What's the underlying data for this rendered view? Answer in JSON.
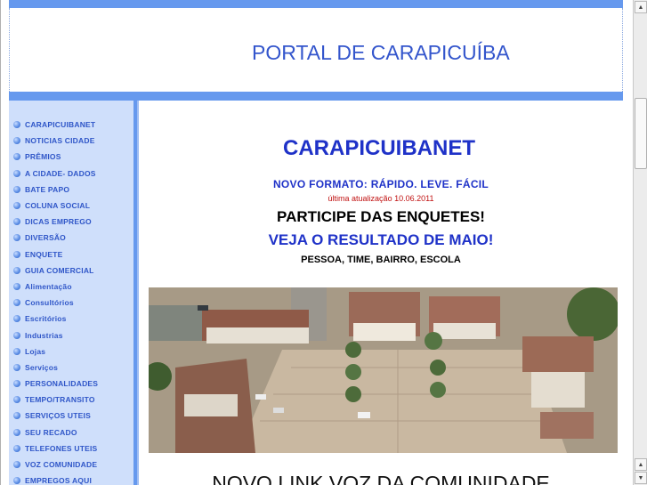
{
  "header": {
    "title": "PORTAL DE CARAPICUÍBA"
  },
  "sidebar": {
    "items": [
      {
        "label": "CARAPICUIBANET"
      },
      {
        "label": "NOTICIAS CIDADE"
      },
      {
        "label": "PRÊMIOS"
      },
      {
        "label": "A CIDADE- DADOS"
      },
      {
        "label": "BATE PAPO"
      },
      {
        "label": "COLUNA SOCIAL"
      },
      {
        "label": "DICAS EMPREGO"
      },
      {
        "label": "DIVERSÃO"
      },
      {
        "label": "ENQUETE"
      },
      {
        "label": "GUIA COMERCIAL"
      },
      {
        "label": "Alimentação"
      },
      {
        "label": "Consultórios"
      },
      {
        "label": "Escritórios"
      },
      {
        "label": "Industrias"
      },
      {
        "label": "Lojas"
      },
      {
        "label": "Serviços"
      },
      {
        "label": "PERSONALIDADES"
      },
      {
        "label": "TEMPO/TRANSITO"
      },
      {
        "label": "SERVIÇOS UTEIS"
      },
      {
        "label": "SEU RECADO"
      },
      {
        "label": "TELEFONES UTEIS"
      },
      {
        "label": "VOZ COMUNIDADE"
      },
      {
        "label": "EMPREGOS AQUI"
      }
    ]
  },
  "main": {
    "site_title": "CARAPICUIBANET",
    "tagline": "NOVO FORMATO: RÁPIDO. LEVE. FÁCIL",
    "updated": "última atualização  10.06.2011",
    "poll_heading": "PARTICIPE DAS ENQUETES!",
    "poll_result": "VEJA O RESULTADO DE MAIO!",
    "poll_topics": "PESSOA, TIME, BAIRRO, ESCOLA",
    "bottom_heading": "NOVO LINK VOZ DA COMUNIDADE"
  },
  "colors": {
    "accent_bar": "#6699ee",
    "sidebar_bg": "#cfdffb",
    "link_blue": "#1f32c8",
    "update_red": "#c01010"
  },
  "icons": {
    "bullet": "blue-dot-icon",
    "scroll_up": "arrow-up-icon",
    "scroll_down": "arrow-down-icon"
  }
}
